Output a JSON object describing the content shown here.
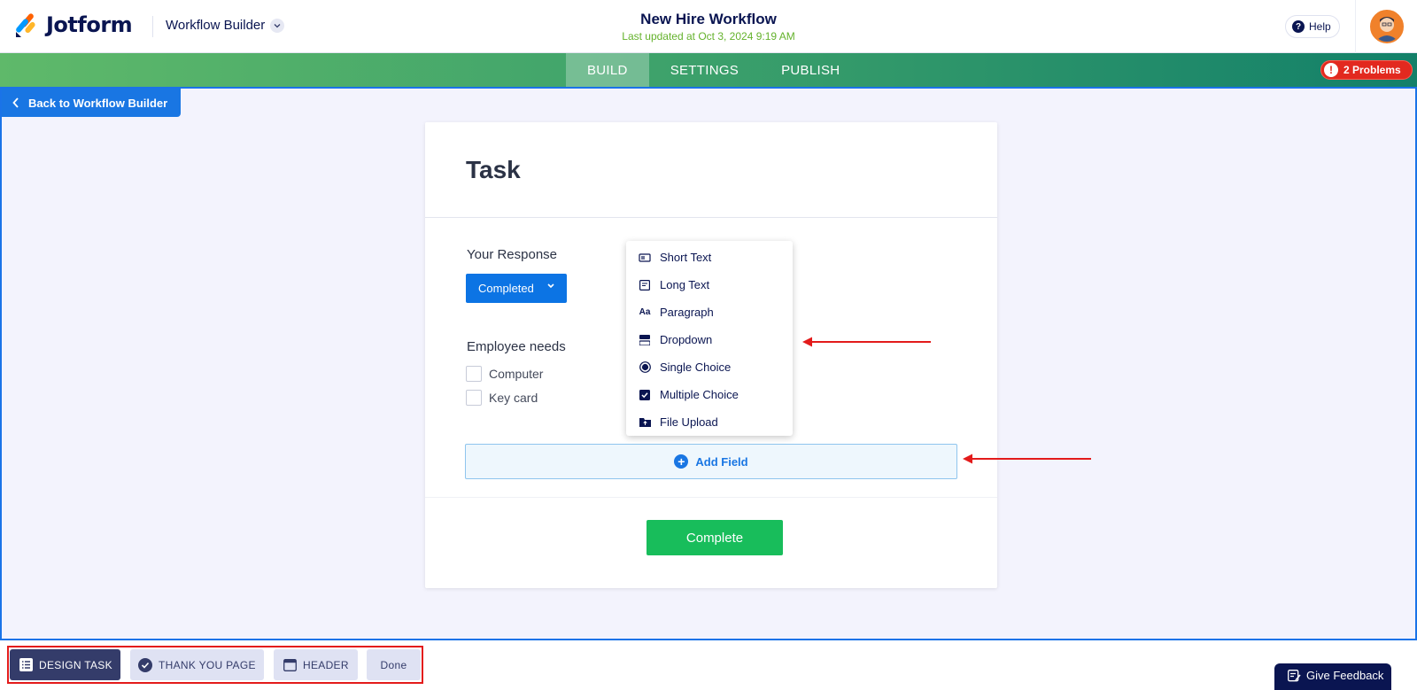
{
  "header": {
    "brand": "Jotform",
    "app_switcher": "Workflow Builder",
    "workflow_title": "New Hire Workflow",
    "last_updated": "Last updated at Oct 3, 2024 9:19 AM",
    "help_label": "Help"
  },
  "nav": {
    "tabs": [
      {
        "label": "BUILD",
        "active": true
      },
      {
        "label": "SETTINGS",
        "active": false
      },
      {
        "label": "PUBLISH",
        "active": false
      }
    ],
    "problems_label": "2 Problems"
  },
  "canvas": {
    "back_label": "Back to Workflow Builder"
  },
  "task_card": {
    "title": "Task",
    "response_label": "Your Response",
    "response_value": "Completed",
    "needs_label": "Employee needs",
    "needs_options": [
      "Computer",
      "Key card"
    ],
    "add_field_label": "Add Field",
    "complete_label": "Complete"
  },
  "field_menu": {
    "items": [
      {
        "label": "Short Text",
        "icon": "short-text-icon"
      },
      {
        "label": "Long Text",
        "icon": "long-text-icon"
      },
      {
        "label": "Paragraph",
        "icon": "paragraph-icon"
      },
      {
        "label": "Dropdown",
        "icon": "dropdown-icon"
      },
      {
        "label": "Single Choice",
        "icon": "radio-icon"
      },
      {
        "label": "Multiple Choice",
        "icon": "checkbox-icon"
      },
      {
        "label": "File Upload",
        "icon": "upload-icon"
      }
    ]
  },
  "bottom_bar": {
    "design_task": "DESIGN TASK",
    "thank_you_page": "THANK YOU PAGE",
    "header": "HEADER",
    "done": "Done",
    "give_feedback": "Give Feedback"
  },
  "colors": {
    "primary_blue": "#1976e3",
    "success_green": "#18bd5b",
    "navy": "#0a1551",
    "error_red": "#e2291f",
    "annotation_red": "#e31b1b"
  }
}
